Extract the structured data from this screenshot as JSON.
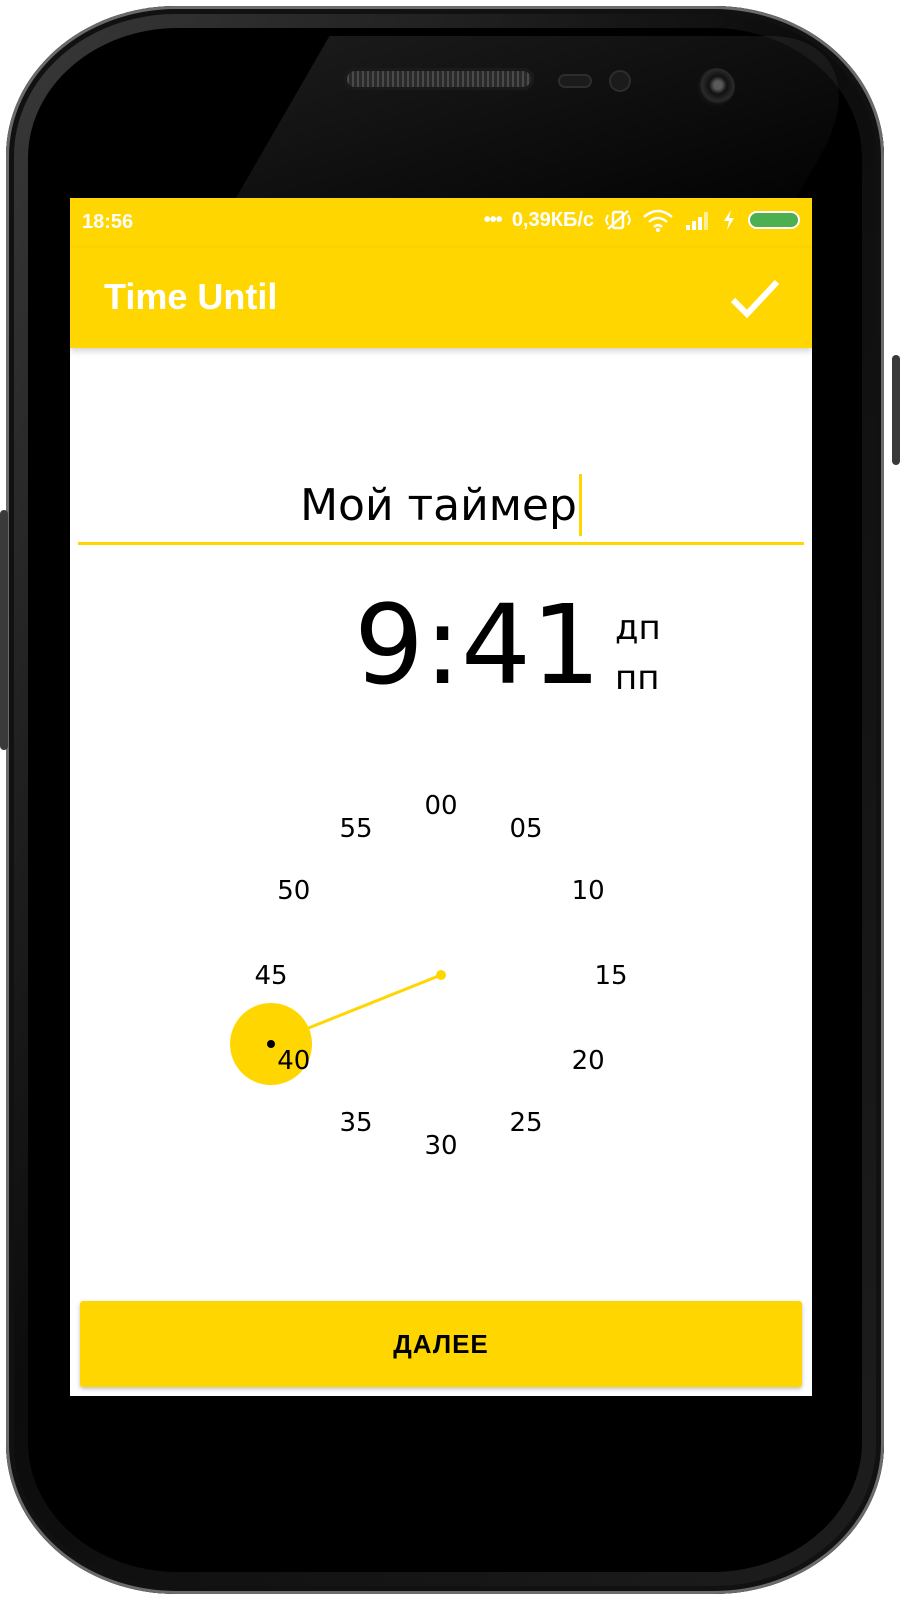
{
  "status_bar": {
    "time": "18:56",
    "dots": "•••",
    "net_speed": "0,39КБ/с",
    "icons": [
      "mute-vibrate-icon",
      "wifi-icon",
      "signal-icon",
      "charging-icon",
      "battery-icon"
    ],
    "battery_color": "#4CAF50"
  },
  "app_bar": {
    "title": "Time Until",
    "confirm_icon": "check-icon"
  },
  "name_input": {
    "value": "Мой таймер"
  },
  "time_display": {
    "time": "9:41",
    "am": "дп",
    "pm": "пп"
  },
  "clock_face": {
    "numbers": [
      "00",
      "05",
      "10",
      "15",
      "20",
      "25",
      "30",
      "35",
      "40",
      "45",
      "50",
      "55"
    ],
    "selected_minute": "40"
  },
  "next_button": {
    "label": "ДАЛЕЕ"
  },
  "colors": {
    "accent": "#FFD600",
    "text": "#000000",
    "on_accent": "#FFFFFF"
  }
}
